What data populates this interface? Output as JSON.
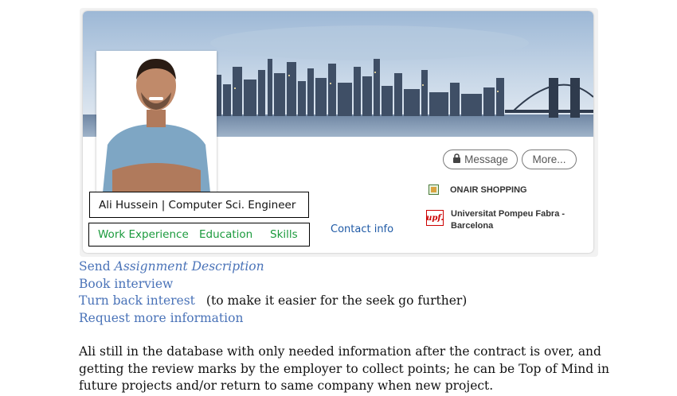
{
  "profile": {
    "name_line": "Ali Hussein | Computer Sci. Engineer",
    "tabs": [
      "Work Experience",
      "Education",
      "Skills"
    ],
    "contact_info": "Contact info",
    "buttons": {
      "message": "Message",
      "more": "More..."
    },
    "company": "ONAIR SHOPPING",
    "university": {
      "logo_text": "upf.",
      "line1": "Universitat Pompeu Fabra -",
      "line2": "Barcelona"
    }
  },
  "actions": {
    "send_prefix": "Send ",
    "send_italic": "Assignment Description",
    "book": "Book interview",
    "turn_back": "Turn back interest",
    "turn_back_note": "(to make it easier for the seek go further)",
    "request": "Request more information"
  },
  "paragraph": "Ali still in the database with only needed information after the contract is over, and getting the review marks by the employer to collect points; he can be Top of Mind in future projects and/or return to same company when new project.",
  "colors": {
    "link": "#4a73b8",
    "tab_green": "#1a9a3c",
    "contact_blue": "#1f5aa6"
  },
  "icons": [
    "city-skyline-banner",
    "lock-icon",
    "company-icon",
    "university-logo"
  ]
}
